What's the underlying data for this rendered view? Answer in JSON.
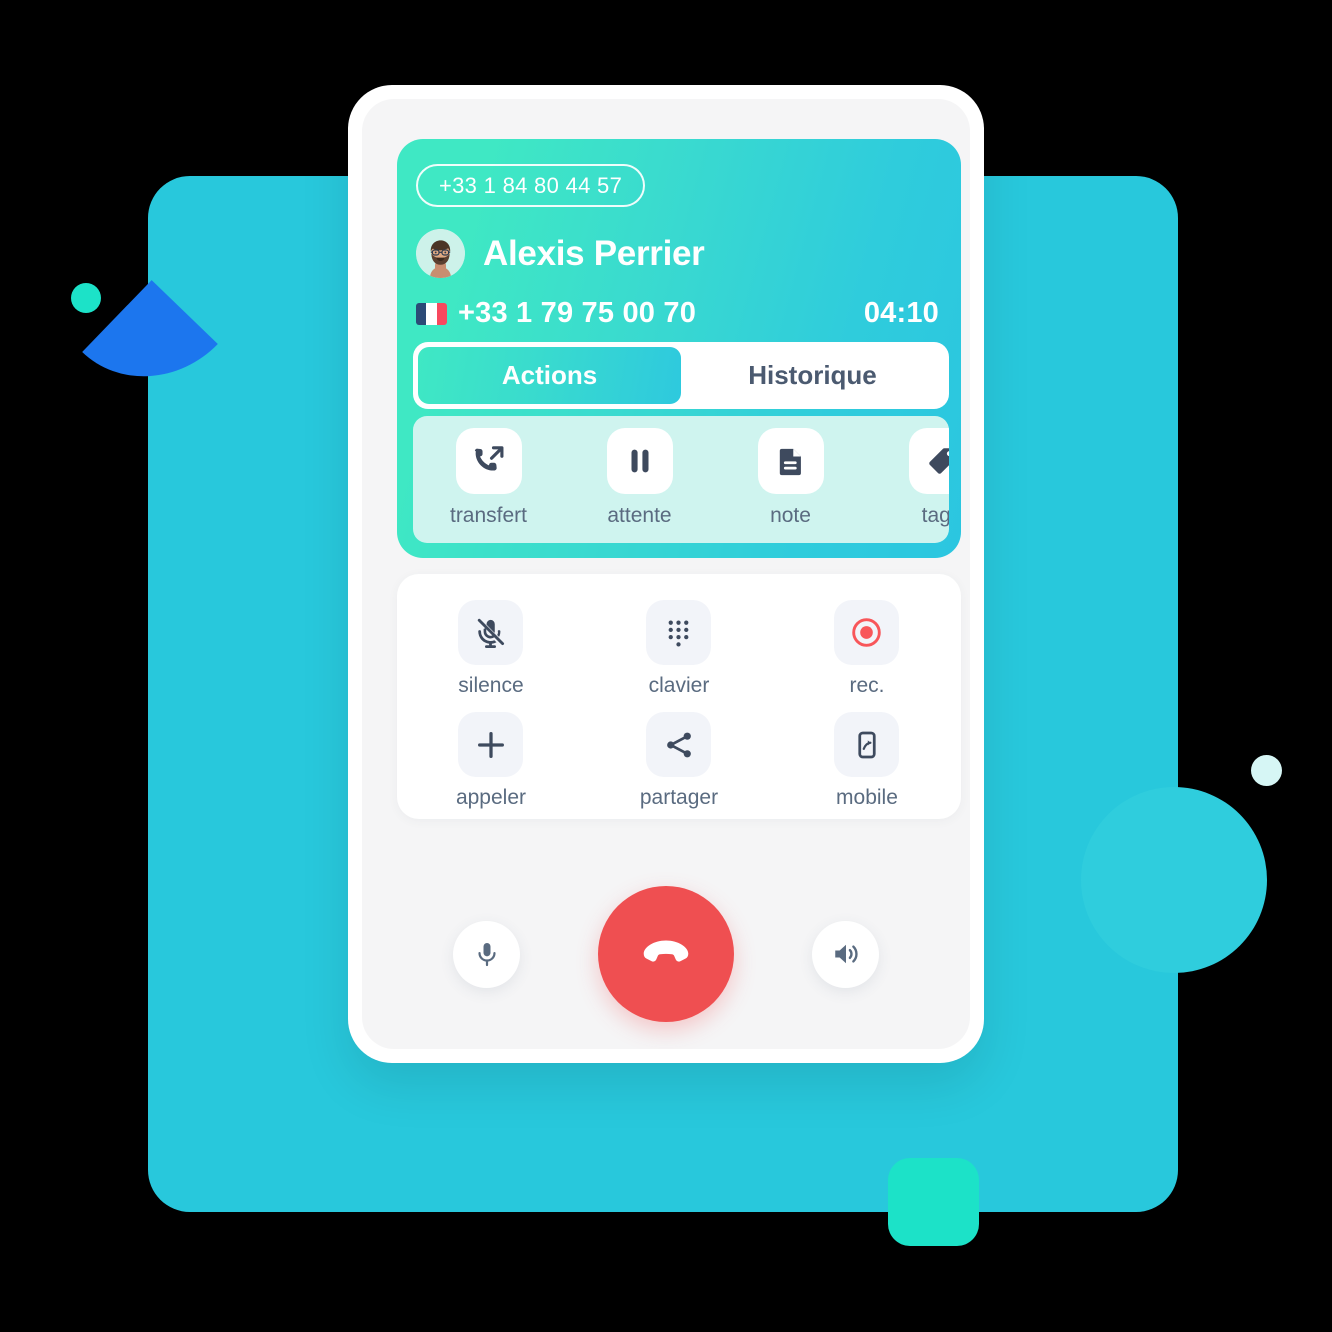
{
  "background": {
    "canvas_color": "#000000",
    "panel_color": "#28C8DC",
    "accent_blue": "#1C76EE",
    "accent_mint": "#1CE2C8",
    "accent_pale": "#D6F6F5"
  },
  "header": {
    "incoming_line_number": "+33 1 84 80 44 57",
    "caller_name": "Alexis Perrier",
    "caller_number": "+33 1 79 75 00 70",
    "country_flag": "france-flag-icon",
    "call_duration": "04:10",
    "avatar_icon": "avatar",
    "gradient_from": "#3FE8C4",
    "gradient_to": "#2BC6E0"
  },
  "tabs": [
    {
      "label": "Actions",
      "active": true,
      "name": "tab-actions"
    },
    {
      "label": "Historique",
      "active": false,
      "name": "tab-historique"
    }
  ],
  "actions": [
    {
      "label": "transfert",
      "icon": "call-transfer-icon"
    },
    {
      "label": "attente",
      "icon": "pause-icon"
    },
    {
      "label": "note",
      "icon": "note-document-icon"
    },
    {
      "label": "tags",
      "icon": "tag-icon"
    }
  ],
  "controls": [
    {
      "label": "silence",
      "icon": "microphone-muted-icon"
    },
    {
      "label": "clavier",
      "icon": "dialpad-icon"
    },
    {
      "label": "rec.",
      "icon": "record-icon",
      "color": "#F8565A"
    },
    {
      "label": "appeler",
      "icon": "plus-icon"
    },
    {
      "label": "partager",
      "icon": "share-icon"
    },
    {
      "label": "mobile",
      "icon": "mobile-transfer-icon"
    }
  ],
  "call_bar": {
    "mic_button": {
      "icon": "microphone-icon",
      "label": ""
    },
    "hangup_button": {
      "icon": "phone-hangup-icon",
      "label": "",
      "color": "#EF4F51"
    },
    "speaker_button": {
      "icon": "speaker-icon",
      "label": ""
    }
  }
}
